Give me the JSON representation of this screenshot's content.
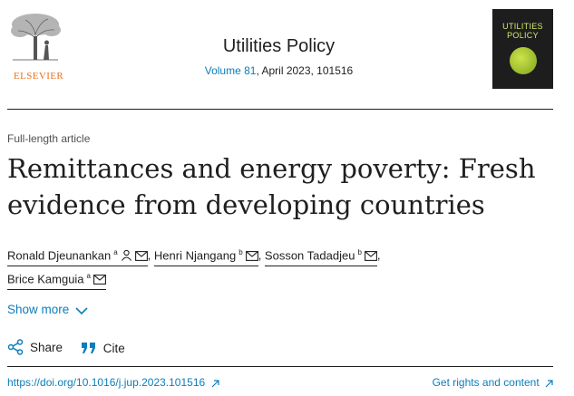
{
  "publisher": {
    "logo_text": "ELSEVIER"
  },
  "journal": {
    "title": "Utilities Policy",
    "volume_link": "Volume 81",
    "issue_details": ", April 2023, 101516",
    "cover_title": "UTILITIES POLICY"
  },
  "article": {
    "type": "Full-length article",
    "title": "Remittances and energy poverty: Fresh evidence from developing countries"
  },
  "authors": [
    {
      "name": "Ronald Djeunankan",
      "affiliation": "a",
      "icons": [
        "person-icon",
        "mail-icon"
      ]
    },
    {
      "name": "Henri Njangang",
      "affiliation": "b",
      "icons": [
        "mail-icon"
      ]
    },
    {
      "name": "Sosson Tadadjeu",
      "affiliation": "b",
      "icons": [
        "mail-icon"
      ]
    },
    {
      "name": "Brice Kamguia",
      "affiliation": "a",
      "icons": [
        "mail-icon"
      ]
    }
  ],
  "actions": {
    "show_more": "Show more",
    "share": "Share",
    "cite": "Cite"
  },
  "footer": {
    "doi": "https://doi.org/10.1016/j.jup.2023.101516",
    "rights": "Get rights and content"
  },
  "colors": {
    "link": "#0c7dbb",
    "publisher_orange": "#e9711c"
  }
}
